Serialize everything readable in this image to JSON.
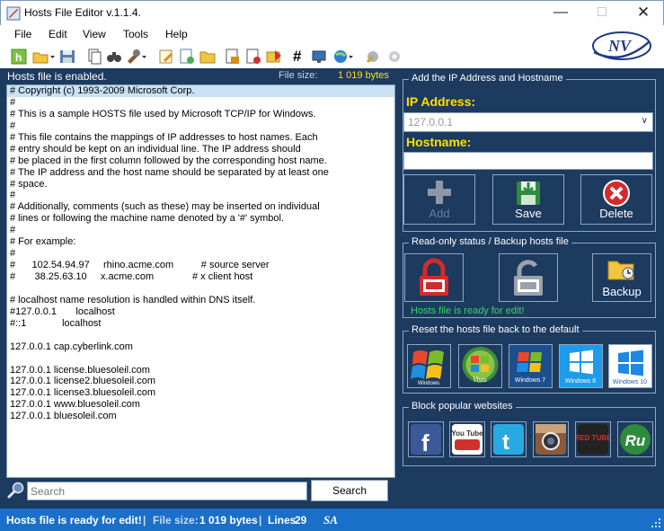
{
  "window": {
    "title": "Hosts File Editor v.1.1.4."
  },
  "menu": [
    "File",
    "Edit",
    "View",
    "Tools",
    "Help"
  ],
  "logo_text": "NV",
  "header": {
    "enabled_text": "Hosts file is enabled.",
    "file_size_label": "File size:",
    "file_size_value": "1 019 bytes"
  },
  "editor": {
    "lines": [
      "# Copyright (c) 1993-2009 Microsoft Corp.",
      "#",
      "# This is a sample HOSTS file used by Microsoft TCP/IP for Windows.",
      "#",
      "# This file contains the mappings of IP addresses to host names. Each",
      "# entry should be kept on an individual line. The IP address should",
      "# be placed in the first column followed by the corresponding host name.",
      "# The IP address and the host name should be separated by at least one",
      "# space.",
      "#",
      "# Additionally, comments (such as these) may be inserted on individual",
      "# lines or following the machine name denoted by a '#' symbol.",
      "#",
      "# For example:",
      "#",
      "#      102.54.94.97     rhino.acme.com          # source server",
      "#       38.25.63.10     x.acme.com              # x client host",
      "",
      "# localhost name resolution is handled within DNS itself.",
      "#127.0.0.1       localhost",
      "#::1             localhost",
      "",
      "127.0.0.1 cap.cyberlink.com",
      "",
      "127.0.0.1 license.bluesoleil.com",
      "127.0.0.1 license2.bluesoleil.com",
      "127.0.0.1 license3.bluesoleil.com",
      "127.0.0.1 www.bluesoleil.com",
      "127.0.0.1 bluesoleil.com"
    ]
  },
  "search": {
    "placeholder": "Search",
    "button": "Search"
  },
  "add_panel": {
    "title": "Add the IP Address  and Hostname",
    "ip_label": "IP Address:",
    "ip_value": "127.0.0.1",
    "hostname_label": "Hostname:",
    "hostname_value": "",
    "add": "Add",
    "save": "Save",
    "delete": "Delete"
  },
  "readonly_panel": {
    "title": "Read-only status / Backup hosts file",
    "backup": "Backup",
    "status": "Hosts file is ready for edit!"
  },
  "reset_panel": {
    "title": "Reset the hosts file back to the default",
    "labels": [
      "Windows",
      "Vista",
      "Windows 7",
      "Windows 8",
      "Windows 10"
    ]
  },
  "block_panel": {
    "title": "Block popular websites",
    "sites": [
      "f",
      "You Tube",
      "t",
      "",
      "RED TUBE",
      "Ru"
    ]
  },
  "statusbar": {
    "ready": "Hosts file is ready for edit!",
    "size_label": "File size:",
    "size_value": "1 019 bytes",
    "lines_label": "Lines",
    "lines_value": "29",
    "author": "SA"
  },
  "colors": {
    "panel": "#1d3a5f",
    "accent_yellow": "#ffe000",
    "status_blue": "#1a6fc9",
    "ready_green": "#3ad16b"
  }
}
